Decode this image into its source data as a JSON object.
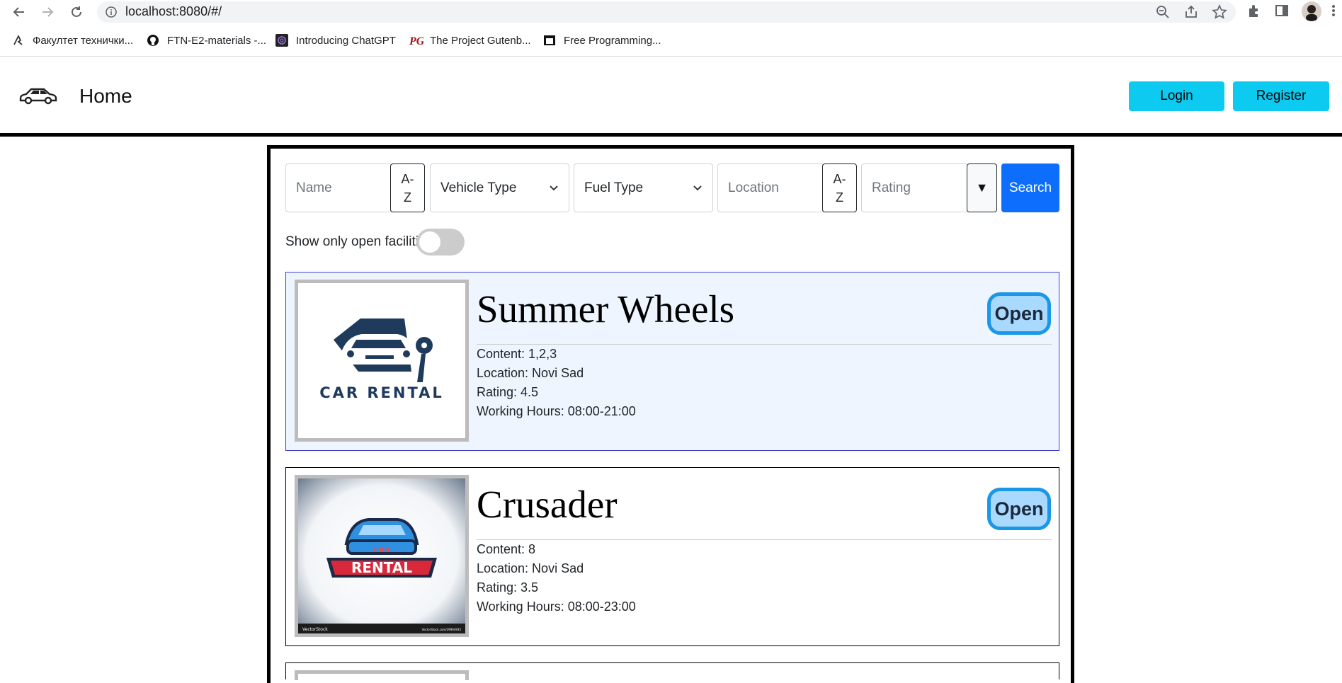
{
  "browser": {
    "url": "localhost:8080/#/",
    "bookmarks": [
      {
        "label": "Факултет технички..."
      },
      {
        "label": "FTN-E2-materials -..."
      },
      {
        "label": "Introducing ChatGPT"
      },
      {
        "label": "The Project Gutenb..."
      },
      {
        "label": "Free Programming..."
      }
    ]
  },
  "header": {
    "title": "Home",
    "login_label": "Login",
    "register_label": "Register"
  },
  "filters": {
    "name_placeholder": "Name",
    "sort_az_top": "A-",
    "sort_az_bottom": "Z",
    "vehicle_type": "Vehicle Type",
    "fuel_type": "Fuel Type",
    "location_placeholder": "Location",
    "rating_placeholder": "Rating",
    "sort_desc_glyph": "▼",
    "search_label": "Search",
    "open_only_label": "Show only open facilitie"
  },
  "facilities": [
    {
      "name": "Summer Wheels",
      "status": "Open",
      "content": "Content: 1,2,3",
      "location": "Location: Novi Sad",
      "rating": "Rating: 4.5",
      "hours": "Working Hours: 08:00-21:00",
      "logo_text": "CAR RENTAL"
    },
    {
      "name": "Crusader",
      "status": "Open",
      "content": "Content: 8",
      "location": "Location: Novi Sad",
      "rating": "Rating: 3.5",
      "hours": "Working Hours: 08:00-23:00",
      "logo_text": "RENTAL",
      "logo_small": "CAR",
      "watermark_left": "VectorStock",
      "watermark_right": "VectorStock.com/29964935"
    }
  ],
  "colors": {
    "accent_cyan": "#0dcaf0",
    "primary_blue": "#0d6efd",
    "badge_border": "#1a97e6",
    "badge_fill": "#aad9ff"
  }
}
